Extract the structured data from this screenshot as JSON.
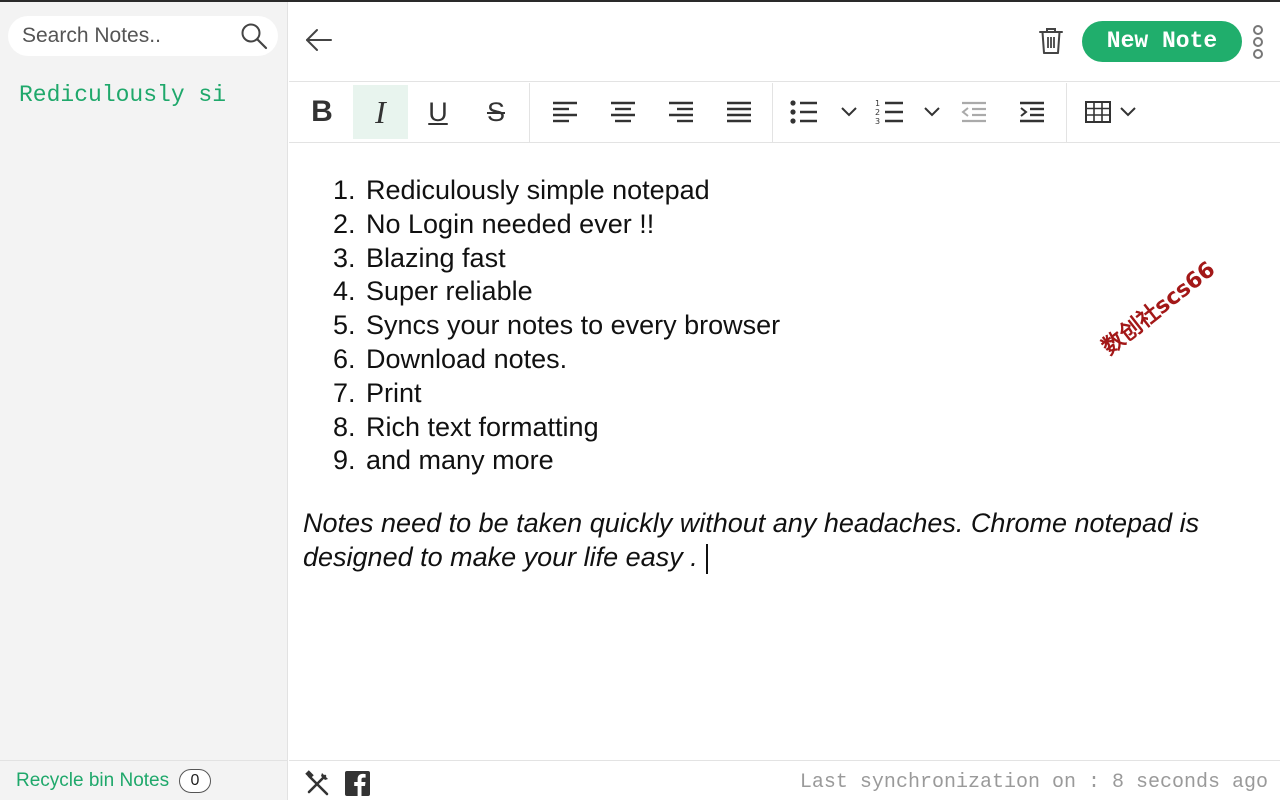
{
  "sidebar": {
    "search_placeholder": "Search Notes..",
    "notes": [
      {
        "title": "Rediculously si"
      }
    ],
    "recycle_label": "Recycle bin Notes",
    "recycle_count": "0"
  },
  "header": {
    "new_note_label": "New Note"
  },
  "toolbar": {
    "bold": "B",
    "italic": "I",
    "underline": "U",
    "strike": "S",
    "active": "italic"
  },
  "editor": {
    "list_items": [
      {
        "n": "1.",
        "text": "Rediculously simple notepad"
      },
      {
        "n": "2.",
        "text": "No Login needed ever !!"
      },
      {
        "n": "3.",
        "text": "Blazing fast"
      },
      {
        "n": "4.",
        "text": "Super reliable"
      },
      {
        "n": "5.",
        "text": "Syncs your notes to every browser"
      },
      {
        "n": "6.",
        "text": "Download notes."
      },
      {
        "n": "7.",
        "text": "Print"
      },
      {
        "n": "8.",
        "text": "Rich text formatting"
      },
      {
        "n": "9.",
        "text": "and many more"
      }
    ],
    "paragraph": "Notes need to be taken quickly without any headaches. Chrome notepad is designed to make your life easy ."
  },
  "watermark": "数创社scs66",
  "footer": {
    "sync_text": "Last synchronization on : 8 seconds ago"
  },
  "colors": {
    "accent": "#20ae6c",
    "sidebar_bg": "#f3f3f3",
    "watermark": "#a31818"
  }
}
